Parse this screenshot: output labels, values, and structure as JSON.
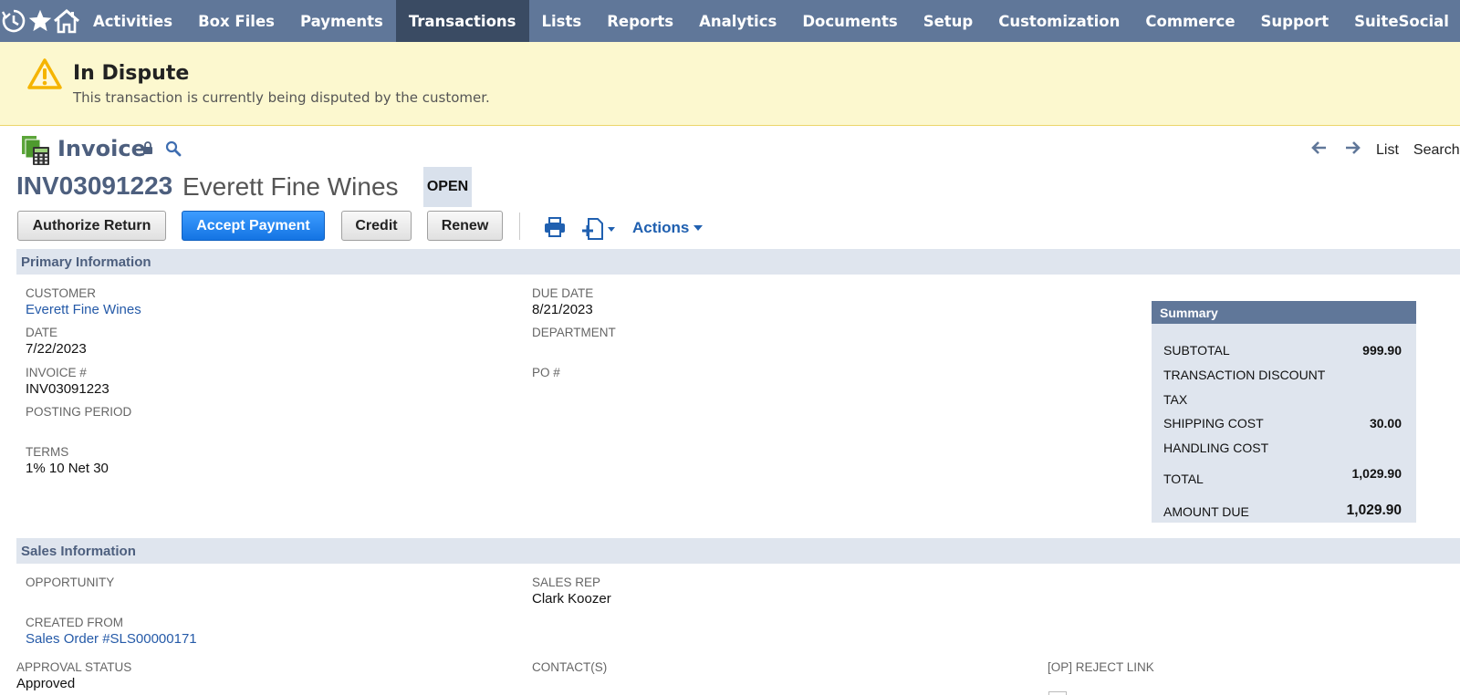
{
  "nav": {
    "icons": [
      "recent-records-icon",
      "favorites-star-icon",
      "home-icon"
    ],
    "items": [
      {
        "label": "Activities",
        "active": false
      },
      {
        "label": "Box Files",
        "active": false
      },
      {
        "label": "Payments",
        "active": false
      },
      {
        "label": "Transactions",
        "active": true
      },
      {
        "label": "Lists",
        "active": false
      },
      {
        "label": "Reports",
        "active": false
      },
      {
        "label": "Analytics",
        "active": false
      },
      {
        "label": "Documents",
        "active": false
      },
      {
        "label": "Setup",
        "active": false
      },
      {
        "label": "Customization",
        "active": false
      },
      {
        "label": "Commerce",
        "active": false
      },
      {
        "label": "Support",
        "active": false
      },
      {
        "label": "SuiteSocial",
        "active": false
      }
    ]
  },
  "banner": {
    "title": "In Dispute",
    "message": "This transaction is currently being disputed by the customer."
  },
  "record": {
    "type": "Invoice",
    "tran_id": "INV03091223",
    "entity": "Everett Fine Wines",
    "status": "OPEN",
    "nav_list": "List",
    "nav_search": "Search"
  },
  "buttons": {
    "authorize_return": "Authorize Return",
    "accept_payment": "Accept Payment",
    "credit": "Credit",
    "renew": "Renew",
    "actions": "Actions"
  },
  "primary": {
    "title": "Primary Information",
    "customer_label": "CUSTOMER",
    "customer_value": "Everett Fine Wines",
    "date_label": "DATE",
    "date_value": "7/22/2023",
    "invoice_label": "INVOICE #",
    "invoice_value": "INV03091223",
    "posting_label": "POSTING PERIOD",
    "terms_label": "TERMS",
    "terms_value": "1% 10 Net 30",
    "due_label": "DUE DATE",
    "due_value": "8/21/2023",
    "dept_label": "DEPARTMENT",
    "po_label": "PO #"
  },
  "summary": {
    "title": "Summary",
    "subtotal_label": "SUBTOTAL",
    "subtotal_value": "999.90",
    "discount_label": "TRANSACTION DISCOUNT",
    "tax_label": "TAX",
    "shipping_label": "SHIPPING COST",
    "shipping_value": "30.00",
    "handling_label": "HANDLING COST",
    "total_label": "TOTAL",
    "total_value": "1,029.90",
    "amount_due_label": "AMOUNT DUE",
    "amount_due_value": "1,029.90"
  },
  "sales": {
    "title": "Sales Information",
    "opportunity_label": "OPPORTUNITY",
    "created_from_label": "CREATED FROM",
    "created_from_value": "Sales Order #SLS00000171",
    "sales_rep_label": "SALES REP",
    "sales_rep_value": "Clark Koozer",
    "approval_label": "APPROVAL STATUS",
    "approval_value": "Approved",
    "contacts_label": "CONTACT(S)",
    "reject_label": "[OP] REJECT LINK"
  },
  "colors": {
    "nav_bg": "#607799",
    "nav_active": "#3a4b63",
    "banner_bg": "#fcf8cf",
    "warning": "#f5b400",
    "primary_button": "#1474e3",
    "section_bg": "#dfe5ee",
    "link": "#255aa8"
  }
}
